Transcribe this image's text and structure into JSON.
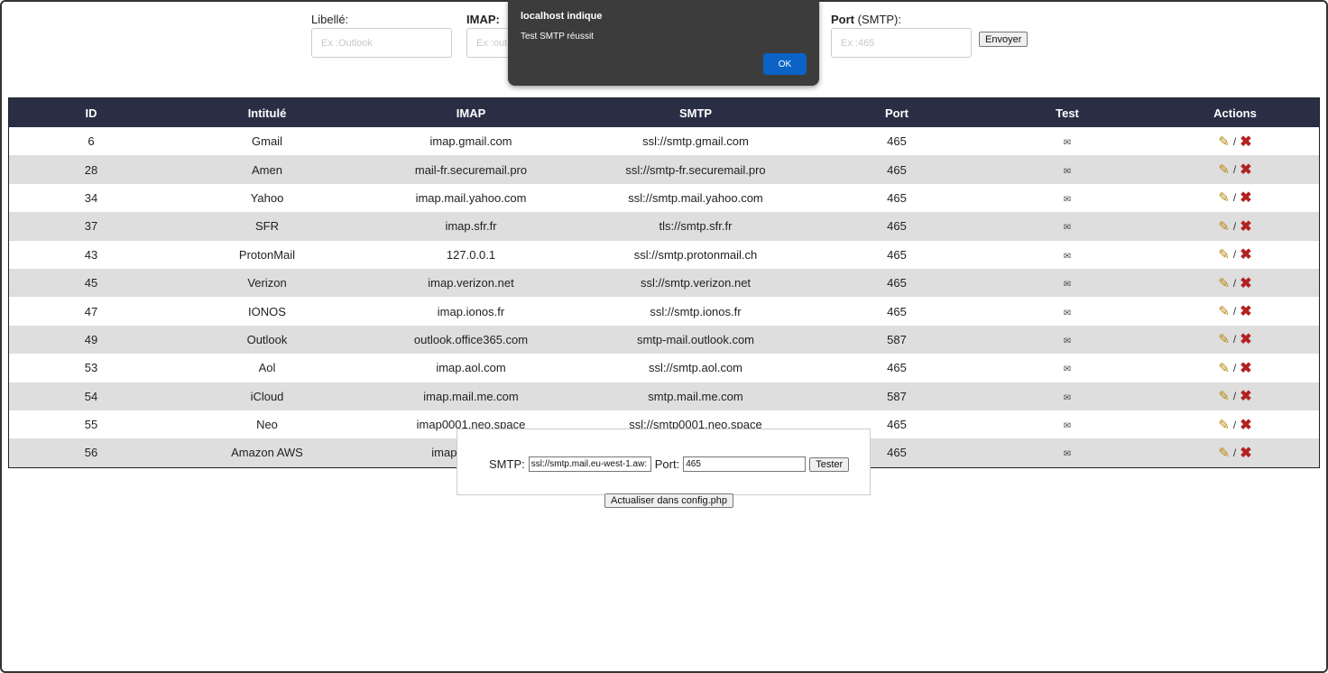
{
  "form": {
    "label_field": {
      "label": "Libellé:",
      "placeholder": "Ex :Outlook"
    },
    "imap_field": {
      "label": "IMAP:",
      "placeholder": "Ex :out"
    },
    "port_field": {
      "label_bold": "Port",
      "label_rest": " (SMTP):",
      "placeholder": "Ex :465"
    },
    "send_label": "Envoyer"
  },
  "table": {
    "headers": [
      "ID",
      "Intitulé",
      "IMAP",
      "SMTP",
      "Port",
      "Test",
      "Actions"
    ],
    "rows": [
      {
        "id": "6",
        "name": "Gmail",
        "imap": "imap.gmail.com",
        "smtp": "ssl://smtp.gmail.com",
        "port": "465"
      },
      {
        "id": "28",
        "name": "Amen",
        "imap": "mail-fr.securemail.pro",
        "smtp": "ssl://smtp-fr.securemail.pro",
        "port": "465"
      },
      {
        "id": "34",
        "name": "Yahoo",
        "imap": "imap.mail.yahoo.com",
        "smtp": "ssl://smtp.mail.yahoo.com",
        "port": "465"
      },
      {
        "id": "37",
        "name": "SFR",
        "imap": "imap.sfr.fr",
        "smtp": "tls://smtp.sfr.fr",
        "port": "465"
      },
      {
        "id": "43",
        "name": "ProtonMail",
        "imap": "127.0.0.1",
        "smtp": "ssl://smtp.protonmail.ch",
        "port": "465"
      },
      {
        "id": "45",
        "name": "Verizon",
        "imap": "imap.verizon.net",
        "smtp": "ssl://smtp.verizon.net",
        "port": "465"
      },
      {
        "id": "47",
        "name": "IONOS",
        "imap": "imap.ionos.fr",
        "smtp": "ssl://smtp.ionos.fr",
        "port": "465"
      },
      {
        "id": "49",
        "name": "Outlook",
        "imap": "outlook.office365.com",
        "smtp": "smtp-mail.outlook.com",
        "port": "587"
      },
      {
        "id": "53",
        "name": "Aol",
        "imap": "imap.aol.com",
        "smtp": "ssl://smtp.aol.com",
        "port": "465"
      },
      {
        "id": "54",
        "name": "iCloud",
        "imap": "imap.mail.me.com",
        "smtp": "smtp.mail.me.com",
        "port": "587"
      },
      {
        "id": "55",
        "name": "Neo",
        "imap": "imap0001.neo.space",
        "smtp": "ssl://smtp0001.neo.space",
        "port": "465"
      },
      {
        "id": "56",
        "name": "Amazon AWS",
        "imap": "imap.mail.eu-w",
        "smtp": "",
        "port": "465"
      }
    ],
    "test_icon": "envelope-icon",
    "edit_icon": "pencil-icon",
    "delete_icon": "delete-x-icon",
    "action_separator": "/"
  },
  "tester": {
    "smtp_label": "SMTP:",
    "smtp_value": "ssl://smtp.mail.eu-west-1.aw:",
    "port_label": "Port:",
    "port_value": "465",
    "test_label": "Tester"
  },
  "update_label": "Actualiser dans config.php",
  "alert": {
    "title": "localhost indique",
    "message": "Test SMTP réussit",
    "ok_label": "OK"
  },
  "colors": {
    "header_bg": "#2a2e45",
    "row_alt": "#dedede",
    "alert_bg": "#3c3c3c",
    "ok_button": "#0b63c5",
    "delete": "#b22222",
    "edit": "#b8860b"
  }
}
